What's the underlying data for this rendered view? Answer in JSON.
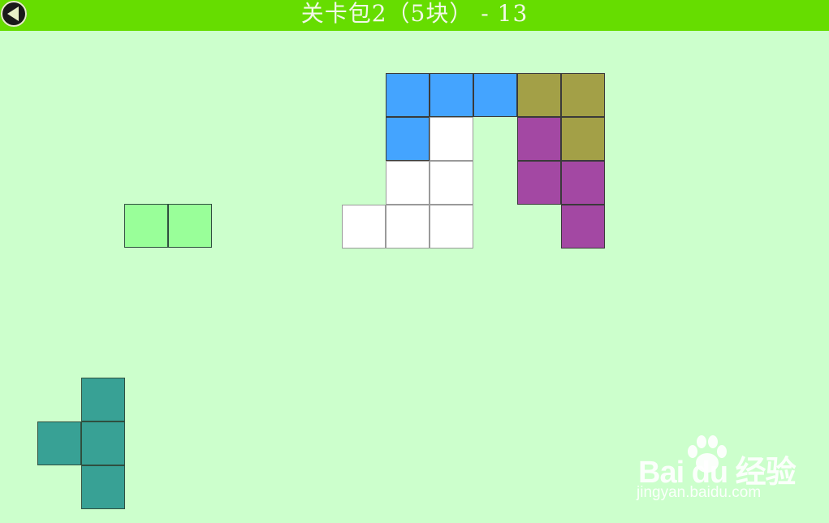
{
  "header": {
    "title": "关卡包2（5块） - 13",
    "back_icon": "back-arrow-icon",
    "bar_color": "#66dd00"
  },
  "board": {
    "cells": [
      {
        "c": 1,
        "r": 0,
        "color": "#44a4ff"
      },
      {
        "c": 2,
        "r": 0,
        "color": "#44a4ff"
      },
      {
        "c": 3,
        "r": 0,
        "color": "#44a4ff"
      },
      {
        "c": 4,
        "r": 0,
        "color": "#a3a047"
      },
      {
        "c": 5,
        "r": 0,
        "color": "#a3a047"
      },
      {
        "c": 1,
        "r": 1,
        "color": "#44a4ff"
      },
      {
        "c": 2,
        "r": 1,
        "color": null
      },
      {
        "c": 4,
        "r": 1,
        "color": "#a348a3"
      },
      {
        "c": 5,
        "r": 1,
        "color": "#a3a047"
      },
      {
        "c": 1,
        "r": 2,
        "color": null
      },
      {
        "c": 2,
        "r": 2,
        "color": null
      },
      {
        "c": 4,
        "r": 2,
        "color": "#a348a3"
      },
      {
        "c": 5,
        "r": 2,
        "color": "#a348a3"
      },
      {
        "c": 0,
        "r": 3,
        "color": null
      },
      {
        "c": 1,
        "r": 3,
        "color": null
      },
      {
        "c": 2,
        "r": 3,
        "color": null
      },
      {
        "c": 5,
        "r": 3,
        "color": "#a348a3"
      }
    ],
    "empty_color": "#ffffff"
  },
  "pieces": [
    {
      "name": "piece-green-domino",
      "color": "#99ff99",
      "cells": [
        [
          0,
          0
        ],
        [
          1,
          0
        ]
      ]
    },
    {
      "name": "piece-teal-t",
      "color": "#38a195",
      "cells": [
        [
          1,
          0
        ],
        [
          0,
          1
        ],
        [
          1,
          1
        ],
        [
          1,
          2
        ]
      ]
    }
  ],
  "watermark": {
    "logo": "Bai du 经验",
    "sub": "jingyan.baidu.com"
  }
}
